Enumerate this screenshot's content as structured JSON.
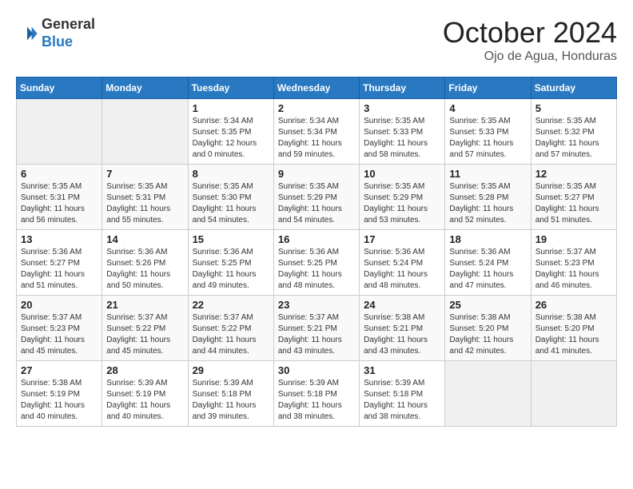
{
  "header": {
    "logo_line1": "General",
    "logo_line2": "Blue",
    "month": "October 2024",
    "location": "Ojo de Agua, Honduras"
  },
  "weekdays": [
    "Sunday",
    "Monday",
    "Tuesday",
    "Wednesday",
    "Thursday",
    "Friday",
    "Saturday"
  ],
  "weeks": [
    [
      {
        "day": "",
        "info": ""
      },
      {
        "day": "",
        "info": ""
      },
      {
        "day": "1",
        "info": "Sunrise: 5:34 AM\nSunset: 5:35 PM\nDaylight: 12 hours\nand 0 minutes."
      },
      {
        "day": "2",
        "info": "Sunrise: 5:34 AM\nSunset: 5:34 PM\nDaylight: 11 hours\nand 59 minutes."
      },
      {
        "day": "3",
        "info": "Sunrise: 5:35 AM\nSunset: 5:33 PM\nDaylight: 11 hours\nand 58 minutes."
      },
      {
        "day": "4",
        "info": "Sunrise: 5:35 AM\nSunset: 5:33 PM\nDaylight: 11 hours\nand 57 minutes."
      },
      {
        "day": "5",
        "info": "Sunrise: 5:35 AM\nSunset: 5:32 PM\nDaylight: 11 hours\nand 57 minutes."
      }
    ],
    [
      {
        "day": "6",
        "info": "Sunrise: 5:35 AM\nSunset: 5:31 PM\nDaylight: 11 hours\nand 56 minutes."
      },
      {
        "day": "7",
        "info": "Sunrise: 5:35 AM\nSunset: 5:31 PM\nDaylight: 11 hours\nand 55 minutes."
      },
      {
        "day": "8",
        "info": "Sunrise: 5:35 AM\nSunset: 5:30 PM\nDaylight: 11 hours\nand 54 minutes."
      },
      {
        "day": "9",
        "info": "Sunrise: 5:35 AM\nSunset: 5:29 PM\nDaylight: 11 hours\nand 54 minutes."
      },
      {
        "day": "10",
        "info": "Sunrise: 5:35 AM\nSunset: 5:29 PM\nDaylight: 11 hours\nand 53 minutes."
      },
      {
        "day": "11",
        "info": "Sunrise: 5:35 AM\nSunset: 5:28 PM\nDaylight: 11 hours\nand 52 minutes."
      },
      {
        "day": "12",
        "info": "Sunrise: 5:35 AM\nSunset: 5:27 PM\nDaylight: 11 hours\nand 51 minutes."
      }
    ],
    [
      {
        "day": "13",
        "info": "Sunrise: 5:36 AM\nSunset: 5:27 PM\nDaylight: 11 hours\nand 51 minutes."
      },
      {
        "day": "14",
        "info": "Sunrise: 5:36 AM\nSunset: 5:26 PM\nDaylight: 11 hours\nand 50 minutes."
      },
      {
        "day": "15",
        "info": "Sunrise: 5:36 AM\nSunset: 5:25 PM\nDaylight: 11 hours\nand 49 minutes."
      },
      {
        "day": "16",
        "info": "Sunrise: 5:36 AM\nSunset: 5:25 PM\nDaylight: 11 hours\nand 48 minutes."
      },
      {
        "day": "17",
        "info": "Sunrise: 5:36 AM\nSunset: 5:24 PM\nDaylight: 11 hours\nand 48 minutes."
      },
      {
        "day": "18",
        "info": "Sunrise: 5:36 AM\nSunset: 5:24 PM\nDaylight: 11 hours\nand 47 minutes."
      },
      {
        "day": "19",
        "info": "Sunrise: 5:37 AM\nSunset: 5:23 PM\nDaylight: 11 hours\nand 46 minutes."
      }
    ],
    [
      {
        "day": "20",
        "info": "Sunrise: 5:37 AM\nSunset: 5:23 PM\nDaylight: 11 hours\nand 45 minutes."
      },
      {
        "day": "21",
        "info": "Sunrise: 5:37 AM\nSunset: 5:22 PM\nDaylight: 11 hours\nand 45 minutes."
      },
      {
        "day": "22",
        "info": "Sunrise: 5:37 AM\nSunset: 5:22 PM\nDaylight: 11 hours\nand 44 minutes."
      },
      {
        "day": "23",
        "info": "Sunrise: 5:37 AM\nSunset: 5:21 PM\nDaylight: 11 hours\nand 43 minutes."
      },
      {
        "day": "24",
        "info": "Sunrise: 5:38 AM\nSunset: 5:21 PM\nDaylight: 11 hours\nand 43 minutes."
      },
      {
        "day": "25",
        "info": "Sunrise: 5:38 AM\nSunset: 5:20 PM\nDaylight: 11 hours\nand 42 minutes."
      },
      {
        "day": "26",
        "info": "Sunrise: 5:38 AM\nSunset: 5:20 PM\nDaylight: 11 hours\nand 41 minutes."
      }
    ],
    [
      {
        "day": "27",
        "info": "Sunrise: 5:38 AM\nSunset: 5:19 PM\nDaylight: 11 hours\nand 40 minutes."
      },
      {
        "day": "28",
        "info": "Sunrise: 5:39 AM\nSunset: 5:19 PM\nDaylight: 11 hours\nand 40 minutes."
      },
      {
        "day": "29",
        "info": "Sunrise: 5:39 AM\nSunset: 5:18 PM\nDaylight: 11 hours\nand 39 minutes."
      },
      {
        "day": "30",
        "info": "Sunrise: 5:39 AM\nSunset: 5:18 PM\nDaylight: 11 hours\nand 38 minutes."
      },
      {
        "day": "31",
        "info": "Sunrise: 5:39 AM\nSunset: 5:18 PM\nDaylight: 11 hours\nand 38 minutes."
      },
      {
        "day": "",
        "info": ""
      },
      {
        "day": "",
        "info": ""
      }
    ]
  ]
}
